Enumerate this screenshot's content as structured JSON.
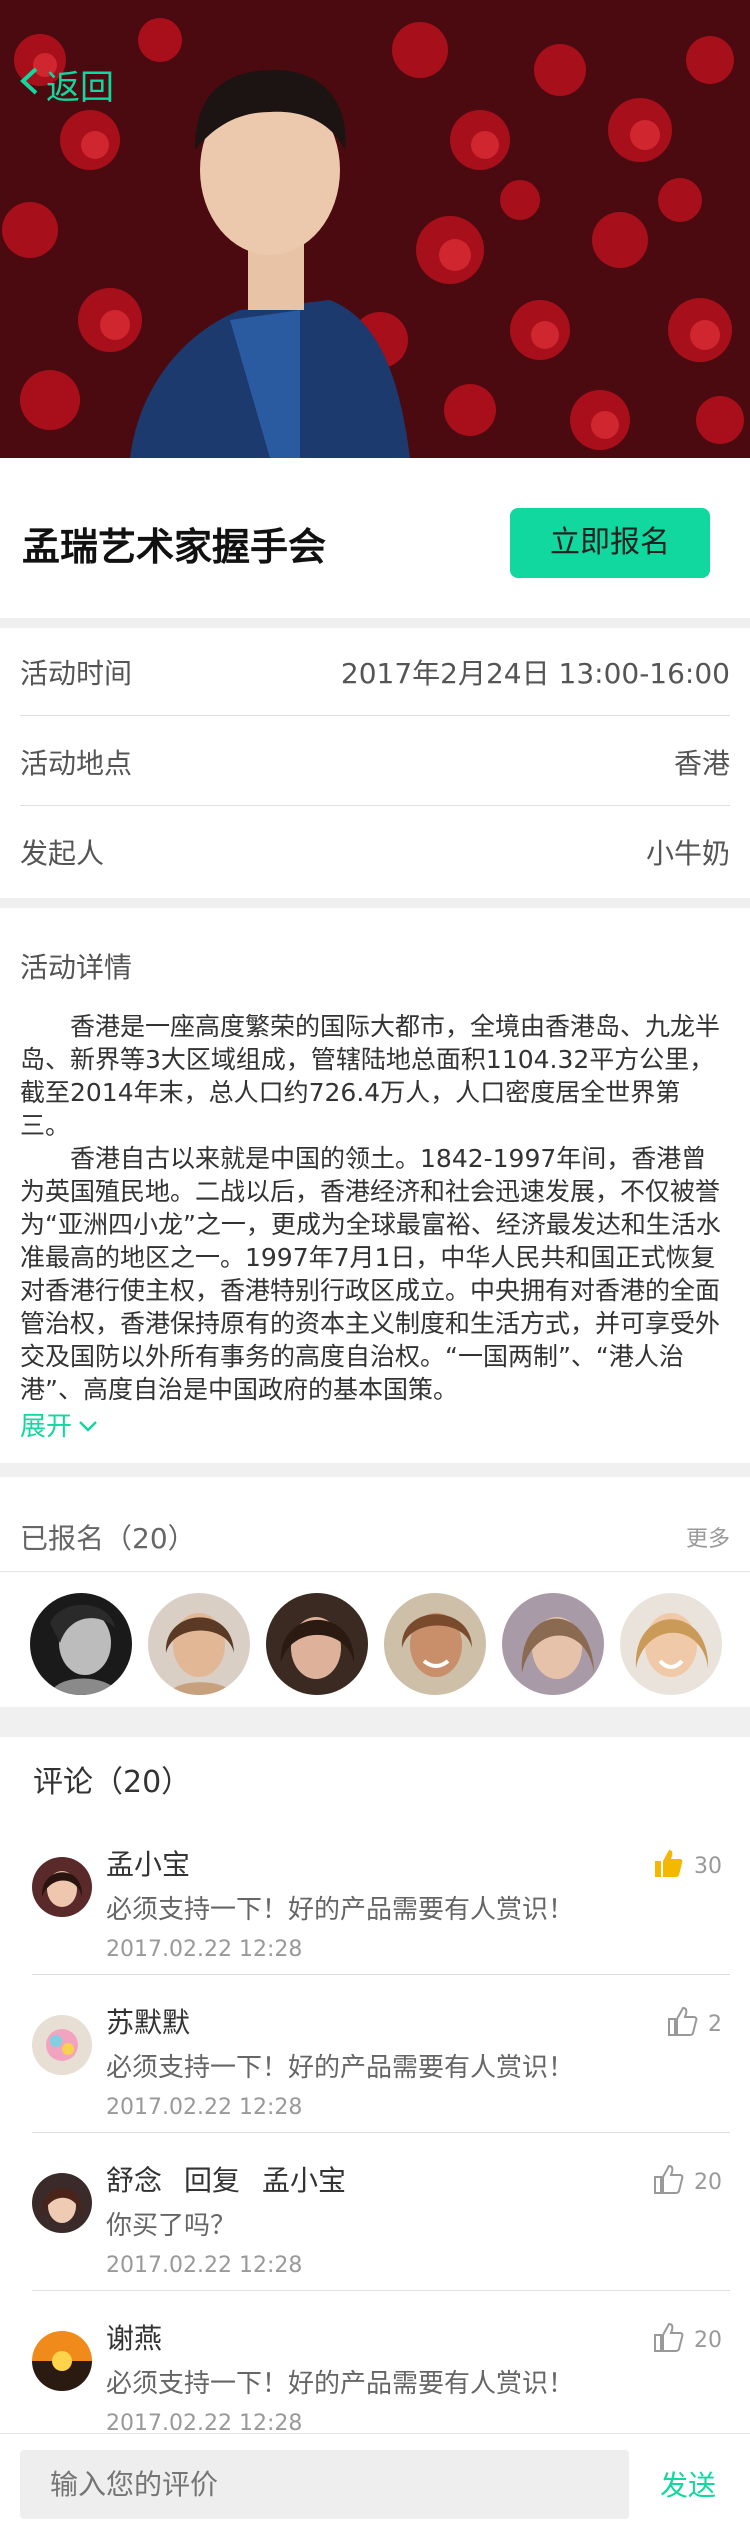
{
  "header": {
    "back_label": "返回"
  },
  "event": {
    "title": "孟瑞艺术家握手会",
    "signup_label": "立即报名"
  },
  "info": [
    {
      "label": "活动时间",
      "value": "2017年2月24日 13:00-16:00"
    },
    {
      "label": "活动地点",
      "value": "香港"
    },
    {
      "label": "发起人",
      "value": "小牛奶"
    }
  ],
  "detail": {
    "heading": "活动详情",
    "paragraphs": [
      "香港是一座高度繁荣的国际大都市，全境由香港岛、九龙半岛、新界等3大区域组成，管辖陆地总面积1104.32平方公里，截至2014年末，总人口约726.4万人，人口密度居全世界第三。",
      "香港自古以来就是中国的领土。1842-1997年间，香港曾为英国殖民地。二战以后，香港经济和社会迅速发展，不仅被誉为“亚洲四小龙”之一，更成为全球最富裕、经济最发达和生活水准最高的地区之一。1997年7月1日，中华人民共和国正式恢复对香港行使主权，香港特别行政区成立。中央拥有对香港的全面管治权，香港保持原有的资本主义制度和生活方式，并可享受外交及国防以外所有事务的高度自治权。“一国两制”、“港人治港”、高度自治是中国政府的基本国策。"
    ],
    "expand_label": "展开"
  },
  "registered": {
    "title": "已报名（20）",
    "more_label": "更多"
  },
  "comments": {
    "title": "评论（20）",
    "items": [
      {
        "name": "孟小宝",
        "reply_label": "",
        "reply_to": "",
        "text": "必须支持一下！好的产品需要有人赏识！",
        "time": "2017.02.22  12:28",
        "likes": "30",
        "liked": true
      },
      {
        "name": "苏默默",
        "reply_label": "",
        "reply_to": "",
        "text": "必须支持一下！好的产品需要有人赏识！",
        "time": "2017.02.22  12:28",
        "likes": "2",
        "liked": false
      },
      {
        "name": "舒念",
        "reply_label": "回复",
        "reply_to": "孟小宝",
        "text": "你买了吗？",
        "time": "2017.02.22  12:28",
        "likes": "20",
        "liked": false
      },
      {
        "name": "谢燕",
        "reply_label": "",
        "reply_to": "",
        "text": "必须支持一下！好的产品需要有人赏识！",
        "time": "2017.02.22  12:28",
        "likes": "20",
        "liked": false
      }
    ]
  },
  "footer": {
    "input_placeholder": "输入您的评价",
    "send_label": "发送"
  },
  "colors": {
    "accent": "#10D89F",
    "muted": "#999999",
    "text": "#333333",
    "secondary": "#666666"
  }
}
